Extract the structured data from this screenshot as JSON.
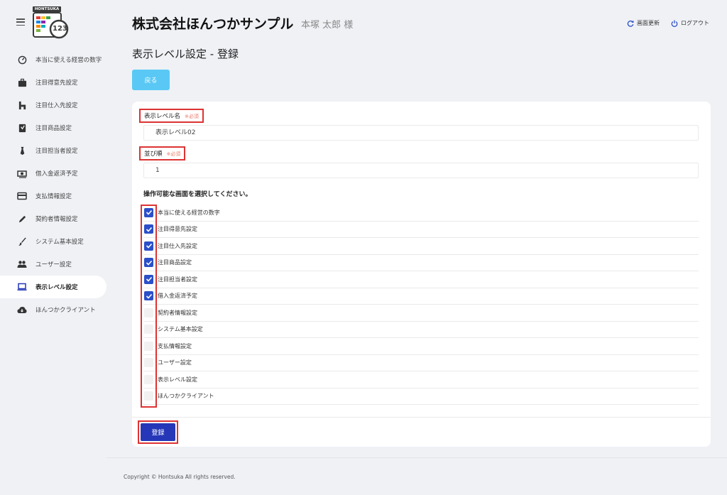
{
  "sidebar": {
    "logo_text": "HONTSUKA",
    "logo_number": "123",
    "items": [
      {
        "label": "本当に使える経営の数字",
        "icon": "speedometer-icon",
        "active": false
      },
      {
        "label": "注目得意先設定",
        "icon": "briefcase-icon",
        "active": false
      },
      {
        "label": "注目仕入先設定",
        "icon": "building-icon",
        "active": false
      },
      {
        "label": "注目商品設定",
        "icon": "bookmark-box-icon",
        "active": false
      },
      {
        "label": "注目担当者設定",
        "icon": "necktie-icon",
        "active": false
      },
      {
        "label": "借入金返済予定",
        "icon": "cash-icon",
        "active": false
      },
      {
        "label": "支払情報設定",
        "icon": "credit-card-icon",
        "active": false
      },
      {
        "label": "契約者情報設定",
        "icon": "pen-icon",
        "active": false
      },
      {
        "label": "システム基本設定",
        "icon": "brush-icon",
        "active": false
      },
      {
        "label": "ユーザー設定",
        "icon": "users-icon",
        "active": false
      },
      {
        "label": "表示レベル設定",
        "icon": "laptop-icon",
        "active": true
      },
      {
        "label": "ほんつかクライアント",
        "icon": "cloud-download-icon",
        "active": false
      }
    ]
  },
  "header": {
    "company": "株式会社ほんつかサンプル",
    "user": "本塚 太郎 様",
    "refresh_label": "画面更新",
    "logout_label": "ログアウト"
  },
  "page": {
    "title": "表示レベル設定 - 登録",
    "back_label": "戻る"
  },
  "form": {
    "level_name_label": "表示レベル名",
    "level_name_required": "※必須",
    "level_name_value": "表示レベル02",
    "order_label": "並び順",
    "order_required": "※必須",
    "order_value": "1",
    "instruction": "操作可能な画面を選択してください。",
    "screens": [
      {
        "label": "本当に使える経営の数字",
        "checked": true
      },
      {
        "label": "注目得意先設定",
        "checked": true
      },
      {
        "label": "注目仕入先設定",
        "checked": true
      },
      {
        "label": "注目商品設定",
        "checked": true
      },
      {
        "label": "注目担当者設定",
        "checked": true
      },
      {
        "label": "借入金返済予定",
        "checked": true
      },
      {
        "label": "契約者情報設定",
        "checked": false
      },
      {
        "label": "システム基本設定",
        "checked": false
      },
      {
        "label": "支払情報設定",
        "checked": false
      },
      {
        "label": "ユーザー設定",
        "checked": false
      },
      {
        "label": "表示レベル設定",
        "checked": false
      },
      {
        "label": "ほんつかクライアント",
        "checked": false
      }
    ],
    "submit_label": "登録"
  },
  "footer": {
    "copyright": "Copyright © Hontsuka All rights reserved."
  },
  "colors": {
    "accent": "#2537b8",
    "back_button": "#5ac8f5",
    "checkbox_checked": "#2b4fc9",
    "highlight_border": "#dd3333",
    "required": "#e87c6a"
  }
}
